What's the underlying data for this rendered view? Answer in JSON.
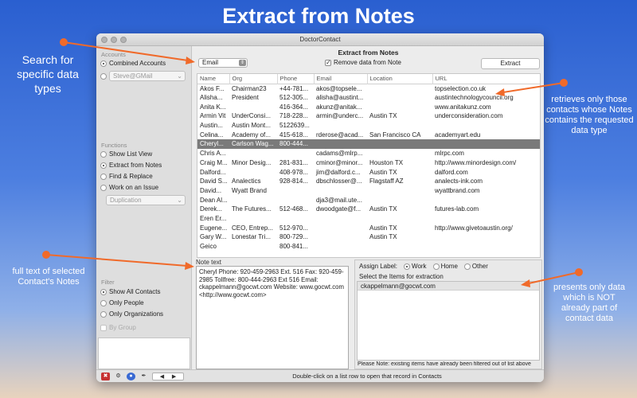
{
  "hero_title": "Extract from Notes",
  "callouts": {
    "left_top": "Search for specific data types",
    "left_bottom": "full text of selected Contact's Notes",
    "right_top": "retrieves only those contacts whose Notes contains the requested data type",
    "right_bottom": "presents only data which is NOT already part of contact data"
  },
  "callout_color": "#f06a2a",
  "window": {
    "title": "DoctorContact"
  },
  "sidebar": {
    "accounts_header": "Accounts",
    "combined_accounts": "Combined Accounts",
    "account_popup": "Steve@GMail",
    "functions_header": "Functions",
    "functions": [
      {
        "label": "Show List View",
        "selected": false
      },
      {
        "label": "Extract from Notes",
        "selected": true
      },
      {
        "label": "Find & Replace",
        "selected": false
      },
      {
        "label": "Work on an Issue",
        "selected": false
      }
    ],
    "function_popup": "Duplication",
    "filter_header": "Filter",
    "filters": [
      {
        "label": "Show All Contacts",
        "selected": true
      },
      {
        "label": "Only People",
        "selected": false
      },
      {
        "label": "Only Organizations",
        "selected": false
      }
    ],
    "by_group": "By Group"
  },
  "panel": {
    "title": "Extract from Notes",
    "type_select": "Email",
    "remove_label": "Remove data from Note",
    "extract_button": "Extract"
  },
  "table": {
    "columns": [
      "Name",
      "Org",
      "Phone",
      "Email",
      "Location",
      "URL"
    ],
    "rows": [
      [
        "Akos F...",
        "Chairman23",
        "+44-781...",
        "akos@topsele...",
        "",
        "topselection.co.uk"
      ],
      [
        "Alisha...",
        "President",
        "512-305...",
        "alisha@austint...",
        "",
        "austintechnologycouncil.org"
      ],
      [
        "Anita K...",
        "",
        "416-364...",
        "akunz@anitak...",
        "",
        "www.anitakunz.com"
      ],
      [
        "Armin Vit",
        "UnderConsi...",
        "718-228...",
        "armin@underc...",
        "Austin TX",
        "underconsideration.com"
      ],
      [
        "Austin...",
        "Austin Mont...",
        "5122639...",
        "",
        "",
        ""
      ],
      [
        "Celina...",
        "Academy of...",
        "415-618...",
        "rderose@acad...",
        "San Francisco CA",
        "academyart.edu"
      ],
      [
        "Cheryl...",
        "Carlson Wag...",
        "800-444...",
        "",
        "",
        ""
      ],
      [
        "Chris A...",
        "",
        "",
        "cadams@mlrp...",
        "",
        "mlrpc.com"
      ],
      [
        "Craig M...",
        "Minor Desig...",
        "281-831...",
        "cminor@minor...",
        "Houston TX",
        "http://www.minordesign.com/"
      ],
      [
        "Dalford...",
        "",
        "408-978...",
        "jim@dalford.c...",
        "Austin TX",
        "dalford.com"
      ],
      [
        "David S...",
        "Analectics",
        "928-814...",
        "dbschlosser@...",
        "Flagstaff AZ",
        "analects-ink.com"
      ],
      [
        "David...",
        "Wyatt Brand",
        "",
        "",
        "",
        "wyattbrand.com"
      ],
      [
        "Dean Al...",
        "",
        "",
        "dja3@mail.ute...",
        "",
        ""
      ],
      [
        "Derek...",
        "The Futures...",
        "512-468...",
        "dwoodgate@f...",
        "Austin TX",
        "futures-lab.com"
      ],
      [
        "Eren Er...",
        "",
        "",
        "",
        "",
        ""
      ],
      [
        "Eugene...",
        "CEO, Entrep...",
        "512-970...",
        "",
        "Austin TX",
        "http://www.givetoaustin.org/"
      ],
      [
        "Gary W...",
        "Lonestar Tri...",
        "800-729...",
        "",
        "Austin TX",
        ""
      ],
      [
        "Geico",
        "",
        "800-841...",
        "",
        "",
        ""
      ]
    ],
    "selected_row": 6
  },
  "note": {
    "label": "Note text",
    "text": "Cheryl  Phone: 920-459-2963 Ext. 516 Fax: 920-459-2985 Tollfree: 800-444-2963 Ext 516 Email: ckappelmann@gocwt.com Website: www.gocwt.com <http://www.gocwt.com>"
  },
  "assign": {
    "label": "Assign Label:",
    "options": [
      {
        "label": "Work",
        "selected": true
      },
      {
        "label": "Home",
        "selected": false
      },
      {
        "label": "Other",
        "selected": false
      }
    ],
    "select_label": "Select the Items for extraction",
    "items": [
      "ckappelmann@gocwt.com"
    ],
    "footer_note": "Please Note: existing items have already been filtered out of list above"
  },
  "status_text": "Double-click on a list row to open that record in Contacts"
}
